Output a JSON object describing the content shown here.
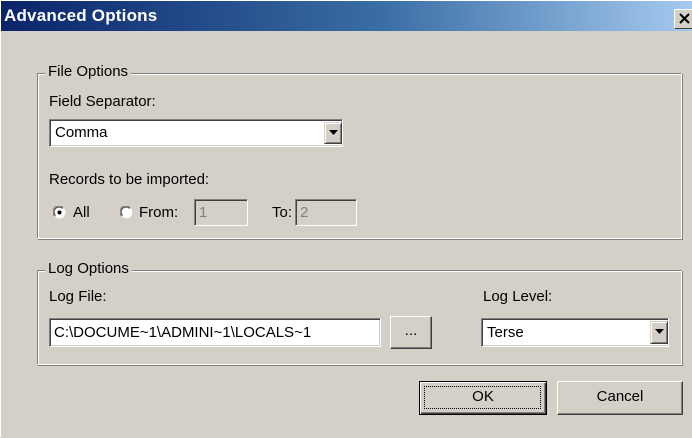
{
  "window": {
    "title": "Advanced Options",
    "close_glyph": "close-icon"
  },
  "file_options": {
    "legend": "File Options",
    "field_separator_label": "Field Separator:",
    "field_separator_value": "Comma",
    "records_label": "Records to be imported:",
    "radio_all_label": "All",
    "radio_all_checked": true,
    "radio_from_label": "From:",
    "radio_from_checked": false,
    "from_value": "1",
    "to_label": "To:",
    "to_value": "2"
  },
  "log_options": {
    "legend": "Log Options",
    "log_file_label": "Log File:",
    "log_file_value": "C:\\DOCUME~1\\ADMINI~1\\LOCALS~1",
    "browse_label": "...",
    "log_level_label": "Log Level:",
    "log_level_value": "Terse"
  },
  "buttons": {
    "ok_label": "OK",
    "cancel_label": "Cancel"
  },
  "colors": {
    "face": "#d4d0c8",
    "title_start": "#0a246a",
    "title_end": "#a6caf0",
    "shadow": "#808080",
    "highlight": "#ffffff"
  }
}
